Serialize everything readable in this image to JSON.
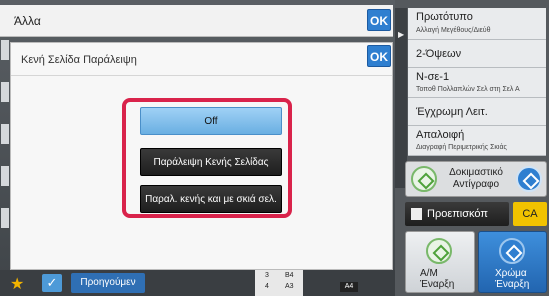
{
  "header": {
    "title": "Άλλα",
    "ok_label": "OK"
  },
  "dialog": {
    "title": "Κενή Σελίδα Παράλειψη",
    "ok_label": "OK",
    "options": [
      {
        "label": "Off",
        "selected": true
      },
      {
        "label": "Παράλειψη Κενής Σελίδας",
        "selected": false
      },
      {
        "label": "Παραλ. κενής και με σκιά σελ.",
        "selected": false
      }
    ]
  },
  "bottom_bar": {
    "prev_label": "Προηγούμεν",
    "tray": {
      "row1_num": "3",
      "row1_size": "B4",
      "row2_num": "4",
      "row2_size": "A3",
      "current_size": "A4"
    }
  },
  "right_panel": {
    "items": [
      {
        "main": "Πρωτότυπο",
        "sub": "Αλλαγή Μεγέθους/Διεύθ"
      },
      {
        "main": "2-Όψεων",
        "sub": ""
      },
      {
        "main": "Ν-σε-1",
        "sub": "Τοποθ Πολλαπλών Σελ στη Σελ Α"
      },
      {
        "main": "Έγχρωμη Λειτ.",
        "sub": ""
      },
      {
        "main": "Απαλοιφή",
        "sub": "Διαγραφή Περιμετρικής Σκιάς"
      }
    ],
    "preview_label_1": "Δοκιμαστικό",
    "preview_label_2": "Αντίγραφο",
    "proepiskopisi_label": "Προεπισκόπ",
    "ca_label": "CA",
    "start_bw_line1": "Α/Μ",
    "start_bw_line2": "Έναρξη",
    "start_color_line1": "Χρώμα",
    "start_color_line2": "Έναρξη"
  },
  "colors": {
    "accent_blue": "#2f7fd0",
    "highlight_red": "#d9234b",
    "ca_yellow": "#f2c300"
  }
}
